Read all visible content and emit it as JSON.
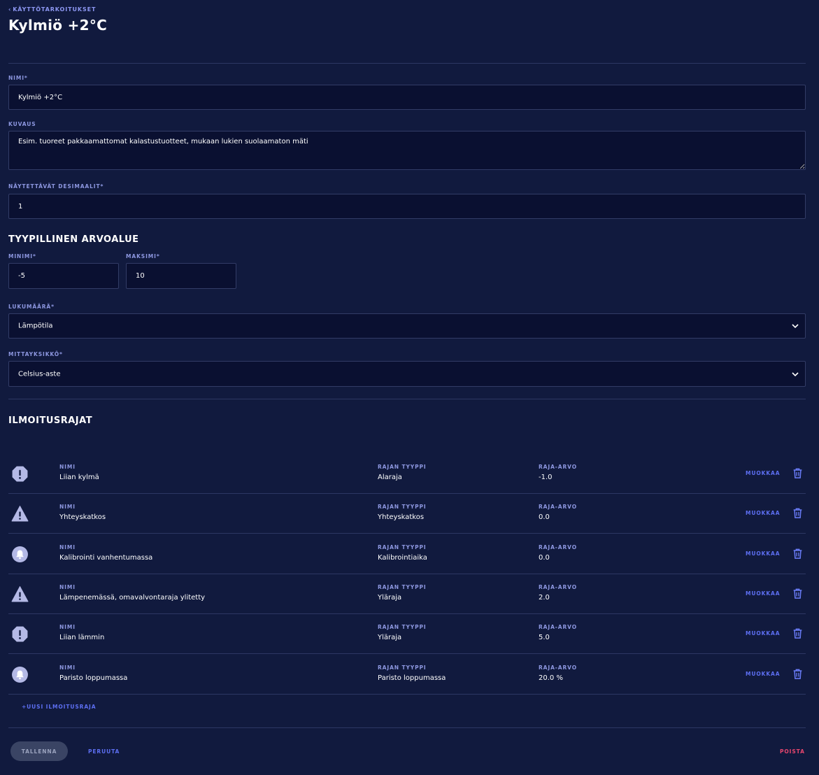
{
  "header": {
    "back_label": "KÄYTTÖTARKOITUKSET",
    "title": "Kylmiö +2°C"
  },
  "form": {
    "name_label": "NIMI*",
    "name_value": "Kylmiö +2°C",
    "description_label": "KUVAUS",
    "description_value": "Esim. tuoreet pakkaamattomat kalastustuotteet, mukaan lukien suolaamaton mäti",
    "decimals_label": "NÄYTETTÄVÄT DESIMAALIT*",
    "decimals_value": "1",
    "range_title": "TYYPILLINEN ARVOALUE",
    "min_label": "MINIMI*",
    "min_value": "-5",
    "max_label": "MAKSIMI*",
    "max_value": "10",
    "quantity_label": "LUKUMÄÄRÄ*",
    "quantity_value": "Lämpötila",
    "unit_label": "MITTAYKSIKKÖ*",
    "unit_value": "Celsius-aste"
  },
  "alerts": {
    "title": "ILMOITUSRAJAT",
    "col_name": "NIMI",
    "col_type": "RAJAN TYYPPI",
    "col_value": "RAJA-ARVO",
    "edit_label": "MUOKKAA",
    "new_label": "+UUSI ILMOITUSRAJA",
    "rows": [
      {
        "icon": "octagon-alert-icon",
        "name": "Liian kylmä",
        "type": "Alaraja",
        "value": "-1.0"
      },
      {
        "icon": "triangle-warning-icon",
        "name": "Yhteyskatkos",
        "type": "Yhteyskatkos",
        "value": "0.0"
      },
      {
        "icon": "bell-icon",
        "name": "Kalibrointi vanhentumassa",
        "type": "Kalibrointiaika",
        "value": "0.0"
      },
      {
        "icon": "triangle-warning-icon",
        "name": "Lämpenemässä, omavalvontaraja ylitetty",
        "type": "Yläraja",
        "value": "2.0"
      },
      {
        "icon": "octagon-alert-icon",
        "name": "Liian lämmin",
        "type": "Yläraja",
        "value": "5.0"
      },
      {
        "icon": "bell-icon",
        "name": "Paristo loppumassa",
        "type": "Paristo loppumassa",
        "value": "20.0 %"
      }
    ]
  },
  "footer": {
    "save_label": "TALLENNA",
    "cancel_label": "PERUUTA",
    "delete_label": "POISTA"
  },
  "colors": {
    "background": "#111a3e",
    "input_background": "#0a1031",
    "accent": "#5d6ff2",
    "danger": "#e8466e",
    "icon_fill": "#b4b9e6"
  }
}
